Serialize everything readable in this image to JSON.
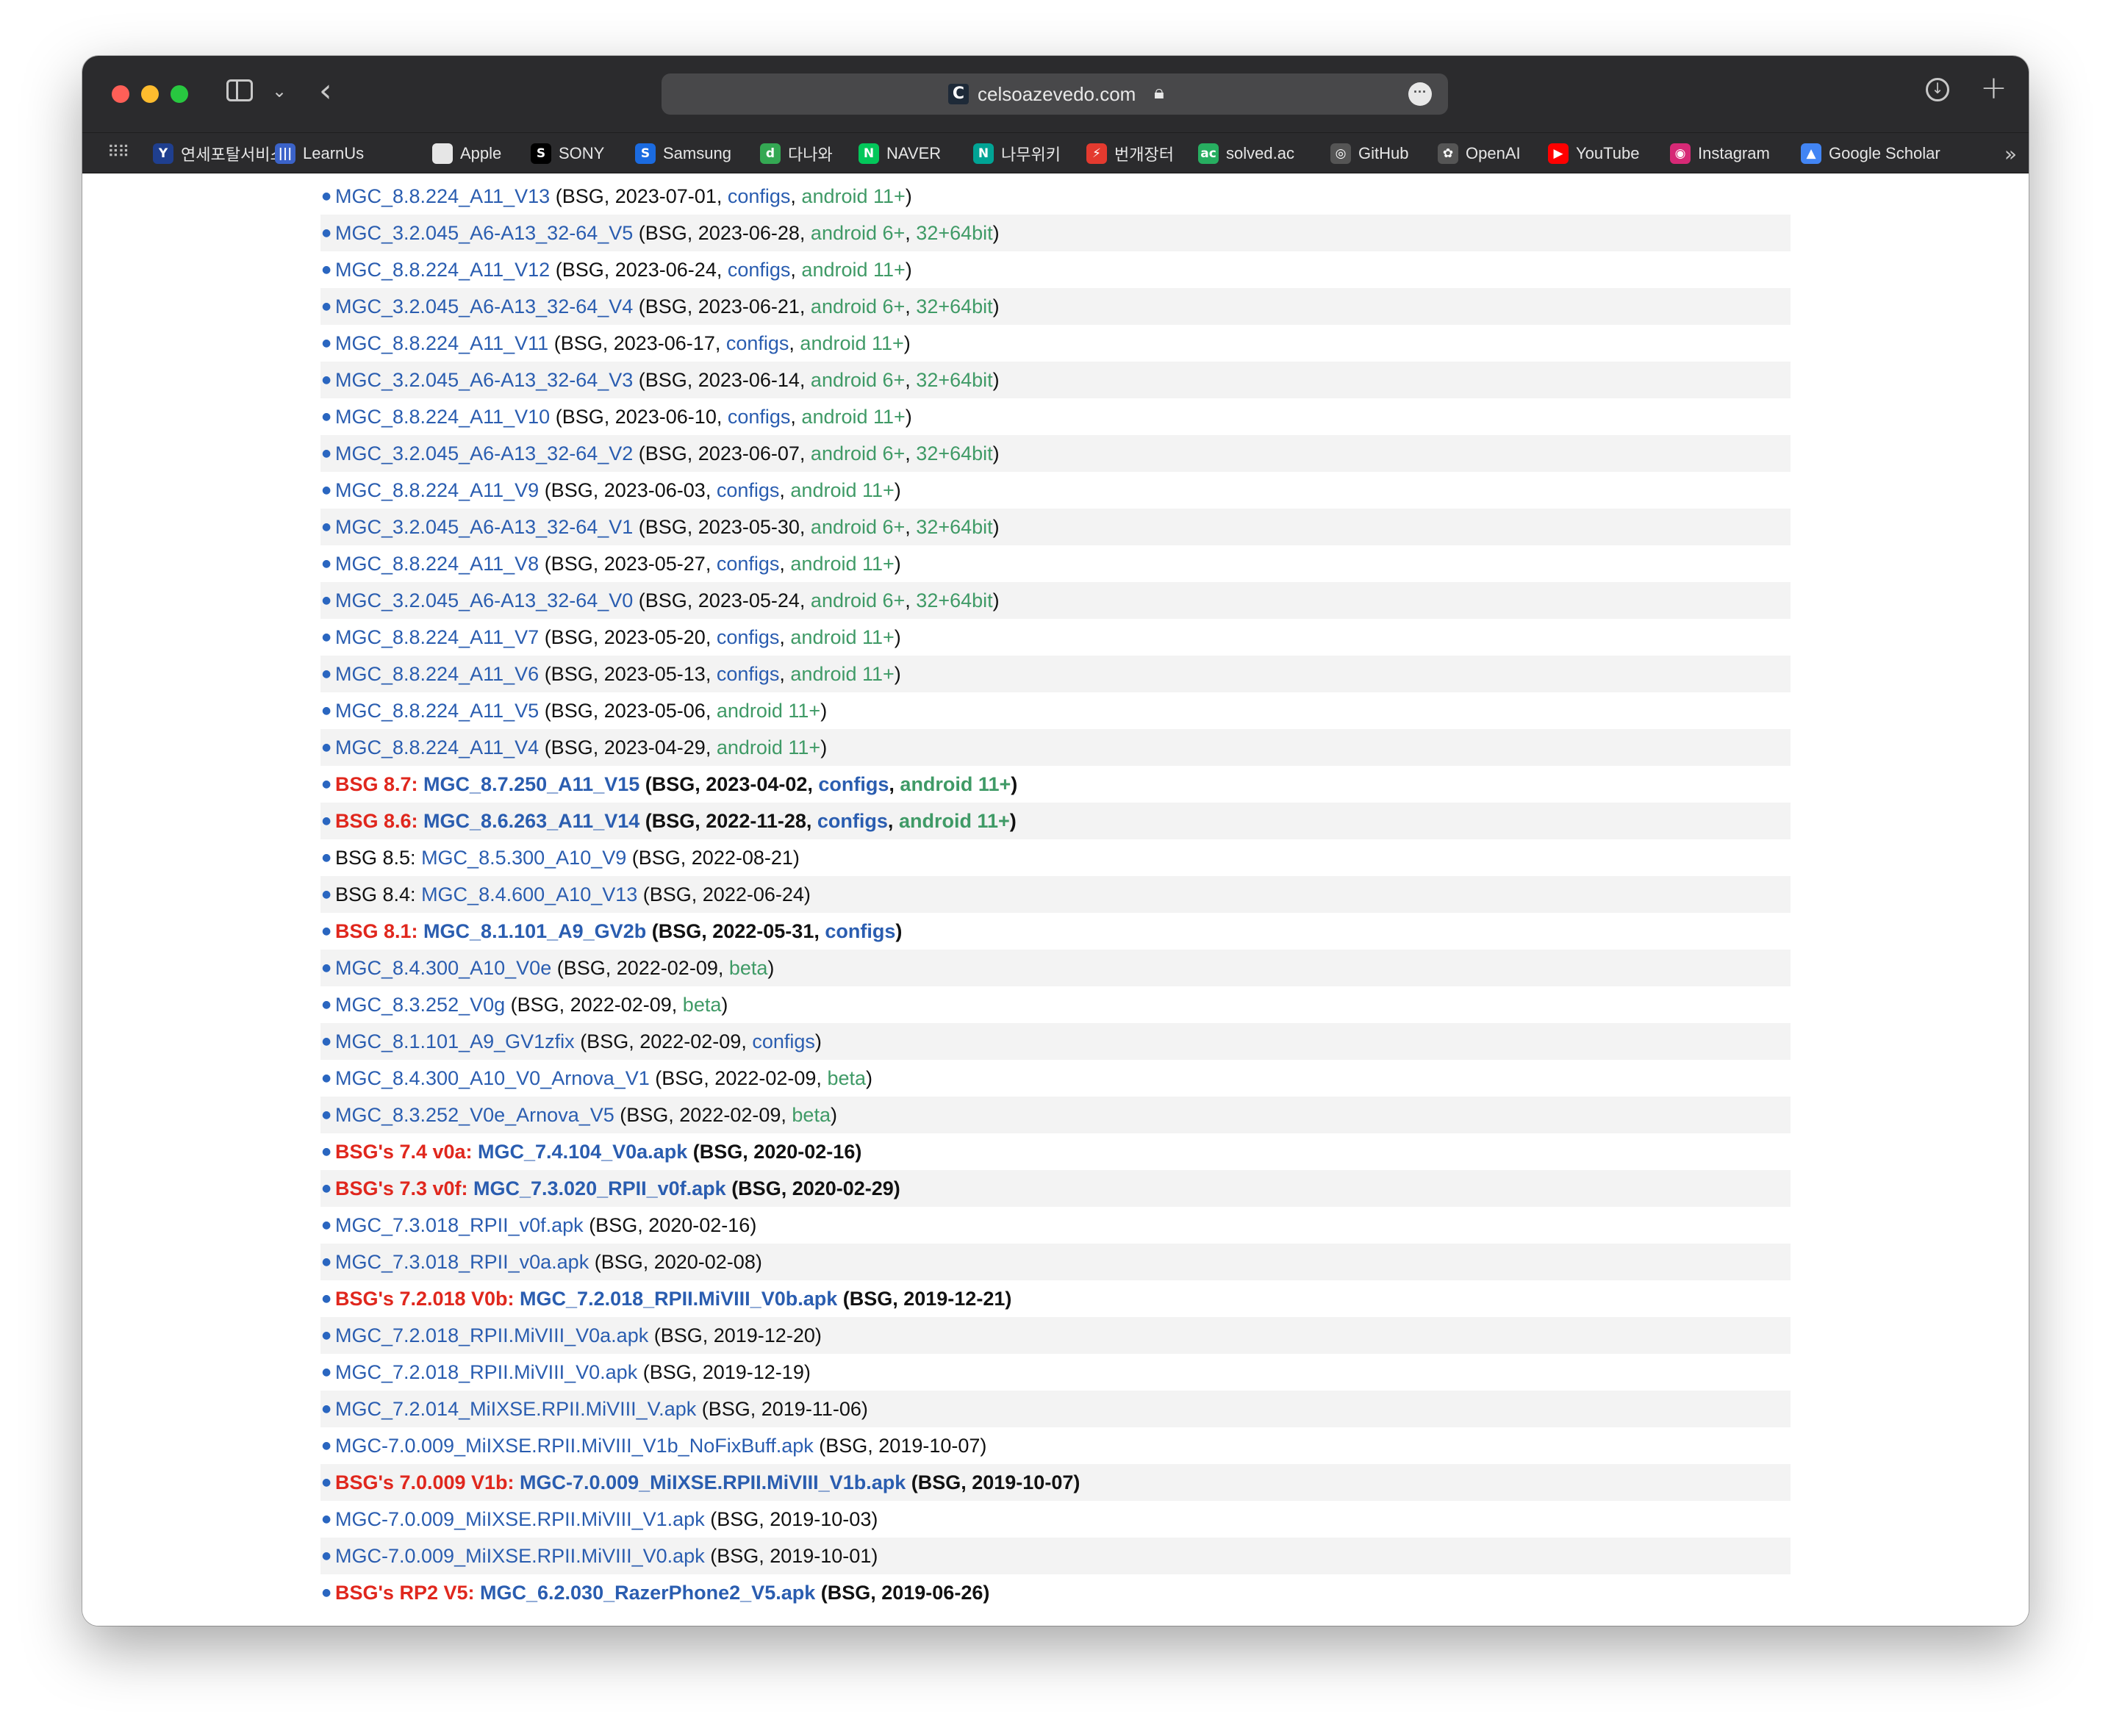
{
  "browser": {
    "url": "celsoazevedo.com",
    "favicon_letter": "C",
    "bookmarks": [
      {
        "label": "연세포탈서비스",
        "icon": "Y",
        "color": "#1f3f8f"
      },
      {
        "label": "LearnUs",
        "icon": "|||",
        "color": "#3b63c9"
      },
      {
        "label": "Apple",
        "icon": "",
        "color": "#e6e6e6"
      },
      {
        "label": "SONY",
        "icon": "S",
        "color": "#000000"
      },
      {
        "label": "Samsung",
        "icon": "S",
        "color": "#1b6be0"
      },
      {
        "label": "다나와",
        "icon": "d",
        "color": "#34a853"
      },
      {
        "label": "NAVER",
        "icon": "N",
        "color": "#03c75a"
      },
      {
        "label": "나무위키",
        "icon": "N",
        "color": "#00a495"
      },
      {
        "label": "번개장터",
        "icon": "⚡",
        "color": "#e43a2f"
      },
      {
        "label": "solved.ac",
        "icon": "ac",
        "color": "#27ae60"
      },
      {
        "label": "GitHub",
        "icon": "◎",
        "color": "#555555"
      },
      {
        "label": "OpenAI",
        "icon": "✿",
        "color": "#555555"
      },
      {
        "label": "YouTube",
        "icon": "▶",
        "color": "#ff0000"
      },
      {
        "label": "Instagram",
        "icon": "◉",
        "color": "#d62976"
      },
      {
        "label": "Google Scholar",
        "icon": "▲",
        "color": "#4285f4"
      }
    ]
  },
  "rows": [
    {
      "bold": false,
      "parts": [
        {
          "t": "MGC_8.8.224_A11_V13",
          "c": "lnk"
        },
        {
          "t": " (BSG, 2023-07-01, ",
          "c": "txt"
        },
        {
          "t": "configs",
          "c": "lnk"
        },
        {
          "t": ", ",
          "c": "txt"
        },
        {
          "t": "android 11+",
          "c": "grn"
        },
        {
          "t": ")",
          "c": "txt"
        }
      ]
    },
    {
      "bold": false,
      "parts": [
        {
          "t": "MGC_3.2.045_A6-A13_32-64_V5",
          "c": "lnk"
        },
        {
          "t": " (BSG, 2023-06-28, ",
          "c": "txt"
        },
        {
          "t": "android 6+",
          "c": "grn"
        },
        {
          "t": ", ",
          "c": "txt"
        },
        {
          "t": "32+64bit",
          "c": "grn"
        },
        {
          "t": ")",
          "c": "txt"
        }
      ]
    },
    {
      "bold": false,
      "parts": [
        {
          "t": "MGC_8.8.224_A11_V12",
          "c": "lnk"
        },
        {
          "t": " (BSG, 2023-06-24, ",
          "c": "txt"
        },
        {
          "t": "configs",
          "c": "lnk"
        },
        {
          "t": ", ",
          "c": "txt"
        },
        {
          "t": "android 11+",
          "c": "grn"
        },
        {
          "t": ")",
          "c": "txt"
        }
      ]
    },
    {
      "bold": false,
      "parts": [
        {
          "t": "MGC_3.2.045_A6-A13_32-64_V4",
          "c": "lnk"
        },
        {
          "t": " (BSG, 2023-06-21, ",
          "c": "txt"
        },
        {
          "t": "android 6+",
          "c": "grn"
        },
        {
          "t": ", ",
          "c": "txt"
        },
        {
          "t": "32+64bit",
          "c": "grn"
        },
        {
          "t": ")",
          "c": "txt"
        }
      ]
    },
    {
      "bold": false,
      "parts": [
        {
          "t": "MGC_8.8.224_A11_V11",
          "c": "lnk"
        },
        {
          "t": " (BSG, 2023-06-17, ",
          "c": "txt"
        },
        {
          "t": "configs",
          "c": "lnk"
        },
        {
          "t": ", ",
          "c": "txt"
        },
        {
          "t": "android 11+",
          "c": "grn"
        },
        {
          "t": ")",
          "c": "txt"
        }
      ]
    },
    {
      "bold": false,
      "parts": [
        {
          "t": "MGC_3.2.045_A6-A13_32-64_V3",
          "c": "lnk"
        },
        {
          "t": " (BSG, 2023-06-14, ",
          "c": "txt"
        },
        {
          "t": "android 6+",
          "c": "grn"
        },
        {
          "t": ", ",
          "c": "txt"
        },
        {
          "t": "32+64bit",
          "c": "grn"
        },
        {
          "t": ")",
          "c": "txt"
        }
      ]
    },
    {
      "bold": false,
      "parts": [
        {
          "t": "MGC_8.8.224_A11_V10",
          "c": "lnk"
        },
        {
          "t": " (BSG, 2023-06-10, ",
          "c": "txt"
        },
        {
          "t": "configs",
          "c": "lnk"
        },
        {
          "t": ", ",
          "c": "txt"
        },
        {
          "t": "android 11+",
          "c": "grn"
        },
        {
          "t": ")",
          "c": "txt"
        }
      ]
    },
    {
      "bold": false,
      "parts": [
        {
          "t": "MGC_3.2.045_A6-A13_32-64_V2",
          "c": "lnk"
        },
        {
          "t": " (BSG, 2023-06-07, ",
          "c": "txt"
        },
        {
          "t": "android 6+",
          "c": "grn"
        },
        {
          "t": ", ",
          "c": "txt"
        },
        {
          "t": "32+64bit",
          "c": "grn"
        },
        {
          "t": ")",
          "c": "txt"
        }
      ]
    },
    {
      "bold": false,
      "parts": [
        {
          "t": "MGC_8.8.224_A11_V9",
          "c": "lnk"
        },
        {
          "t": " (BSG, 2023-06-03, ",
          "c": "txt"
        },
        {
          "t": "configs",
          "c": "lnk"
        },
        {
          "t": ", ",
          "c": "txt"
        },
        {
          "t": "android 11+",
          "c": "grn"
        },
        {
          "t": ")",
          "c": "txt"
        }
      ]
    },
    {
      "bold": false,
      "parts": [
        {
          "t": "MGC_3.2.045_A6-A13_32-64_V1",
          "c": "lnk"
        },
        {
          "t": " (BSG, 2023-05-30, ",
          "c": "txt"
        },
        {
          "t": "android 6+",
          "c": "grn"
        },
        {
          "t": ", ",
          "c": "txt"
        },
        {
          "t": "32+64bit",
          "c": "grn"
        },
        {
          "t": ")",
          "c": "txt"
        }
      ]
    },
    {
      "bold": false,
      "parts": [
        {
          "t": "MGC_8.8.224_A11_V8",
          "c": "lnk"
        },
        {
          "t": " (BSG, 2023-05-27, ",
          "c": "txt"
        },
        {
          "t": "configs",
          "c": "lnk"
        },
        {
          "t": ", ",
          "c": "txt"
        },
        {
          "t": "android 11+",
          "c": "grn"
        },
        {
          "t": ")",
          "c": "txt"
        }
      ]
    },
    {
      "bold": false,
      "parts": [
        {
          "t": "MGC_3.2.045_A6-A13_32-64_V0",
          "c": "lnk"
        },
        {
          "t": " (BSG, 2023-05-24, ",
          "c": "txt"
        },
        {
          "t": "android 6+",
          "c": "grn"
        },
        {
          "t": ", ",
          "c": "txt"
        },
        {
          "t": "32+64bit",
          "c": "grn"
        },
        {
          "t": ")",
          "c": "txt"
        }
      ]
    },
    {
      "bold": false,
      "parts": [
        {
          "t": "MGC_8.8.224_A11_V7",
          "c": "lnk"
        },
        {
          "t": " (BSG, 2023-05-20, ",
          "c": "txt"
        },
        {
          "t": "configs",
          "c": "lnk"
        },
        {
          "t": ", ",
          "c": "txt"
        },
        {
          "t": "android 11+",
          "c": "grn"
        },
        {
          "t": ")",
          "c": "txt"
        }
      ]
    },
    {
      "bold": false,
      "parts": [
        {
          "t": "MGC_8.8.224_A11_V6",
          "c": "lnk"
        },
        {
          "t": " (BSG, 2023-05-13, ",
          "c": "txt"
        },
        {
          "t": "configs",
          "c": "lnk"
        },
        {
          "t": ", ",
          "c": "txt"
        },
        {
          "t": "android 11+",
          "c": "grn"
        },
        {
          "t": ")",
          "c": "txt"
        }
      ]
    },
    {
      "bold": false,
      "parts": [
        {
          "t": "MGC_8.8.224_A11_V5",
          "c": "lnk"
        },
        {
          "t": " (BSG, 2023-05-06, ",
          "c": "txt"
        },
        {
          "t": "android 11+",
          "c": "grn"
        },
        {
          "t": ")",
          "c": "txt"
        }
      ]
    },
    {
      "bold": false,
      "parts": [
        {
          "t": "MGC_8.8.224_A11_V4",
          "c": "lnk"
        },
        {
          "t": " (BSG, 2023-04-29, ",
          "c": "txt"
        },
        {
          "t": "android 11+",
          "c": "grn"
        },
        {
          "t": ")",
          "c": "txt"
        }
      ]
    },
    {
      "bold": true,
      "parts": [
        {
          "t": "BSG 8.7: ",
          "c": "red"
        },
        {
          "t": "MGC_8.7.250_A11_V15",
          "c": "lnk"
        },
        {
          "t": " (BSG, 2023-04-02, ",
          "c": "txt"
        },
        {
          "t": "configs",
          "c": "lnk"
        },
        {
          "t": ", ",
          "c": "txt"
        },
        {
          "t": "android 11+",
          "c": "grn"
        },
        {
          "t": ")",
          "c": "txt"
        }
      ]
    },
    {
      "bold": true,
      "parts": [
        {
          "t": "BSG 8.6: ",
          "c": "red"
        },
        {
          "t": "MGC_8.6.263_A11_V14",
          "c": "lnk"
        },
        {
          "t": " (BSG, 2022-11-28, ",
          "c": "txt"
        },
        {
          "t": "configs",
          "c": "lnk"
        },
        {
          "t": ", ",
          "c": "txt"
        },
        {
          "t": "android 11+",
          "c": "grn"
        },
        {
          "t": ")",
          "c": "txt"
        }
      ]
    },
    {
      "bold": false,
      "parts": [
        {
          "t": "BSG 8.5: ",
          "c": "txt"
        },
        {
          "t": "MGC_8.5.300_A10_V9",
          "c": "lnk"
        },
        {
          "t": " (BSG, 2022-08-21)",
          "c": "txt"
        }
      ]
    },
    {
      "bold": false,
      "parts": [
        {
          "t": "BSG 8.4: ",
          "c": "txt"
        },
        {
          "t": "MGC_8.4.600_A10_V13",
          "c": "lnk"
        },
        {
          "t": " (BSG, 2022-06-24)",
          "c": "txt"
        }
      ]
    },
    {
      "bold": true,
      "parts": [
        {
          "t": "BSG 8.1: ",
          "c": "red"
        },
        {
          "t": "MGC_8.1.101_A9_GV2b",
          "c": "lnk"
        },
        {
          "t": " (BSG, 2022-05-31, ",
          "c": "txt"
        },
        {
          "t": "configs",
          "c": "lnk"
        },
        {
          "t": ")",
          "c": "txt"
        }
      ]
    },
    {
      "bold": false,
      "parts": [
        {
          "t": "MGC_8.4.300_A10_V0e",
          "c": "lnk"
        },
        {
          "t": " (BSG, 2022-02-09, ",
          "c": "txt"
        },
        {
          "t": "beta",
          "c": "grn"
        },
        {
          "t": ")",
          "c": "txt"
        }
      ]
    },
    {
      "bold": false,
      "parts": [
        {
          "t": "MGC_8.3.252_V0g",
          "c": "lnk"
        },
        {
          "t": " (BSG, 2022-02-09, ",
          "c": "txt"
        },
        {
          "t": "beta",
          "c": "grn"
        },
        {
          "t": ")",
          "c": "txt"
        }
      ]
    },
    {
      "bold": false,
      "parts": [
        {
          "t": "MGC_8.1.101_A9_GV1zfix",
          "c": "lnk"
        },
        {
          "t": " (BSG, 2022-02-09, ",
          "c": "txt"
        },
        {
          "t": "configs",
          "c": "lnk"
        },
        {
          "t": ")",
          "c": "txt"
        }
      ]
    },
    {
      "bold": false,
      "parts": [
        {
          "t": "MGC_8.4.300_A10_V0_Arnova_V1",
          "c": "lnk"
        },
        {
          "t": " (BSG, 2022-02-09, ",
          "c": "txt"
        },
        {
          "t": "beta",
          "c": "grn"
        },
        {
          "t": ")",
          "c": "txt"
        }
      ]
    },
    {
      "bold": false,
      "parts": [
        {
          "t": "MGC_8.3.252_V0e_Arnova_V5",
          "c": "lnk"
        },
        {
          "t": " (BSG, 2022-02-09, ",
          "c": "txt"
        },
        {
          "t": "beta",
          "c": "grn"
        },
        {
          "t": ")",
          "c": "txt"
        }
      ]
    },
    {
      "bold": true,
      "parts": [
        {
          "t": "BSG's 7.4 v0a: ",
          "c": "red"
        },
        {
          "t": "MGC_7.4.104_V0a.apk",
          "c": "lnk"
        },
        {
          "t": " (BSG, 2020-02-16)",
          "c": "txt"
        }
      ]
    },
    {
      "bold": true,
      "parts": [
        {
          "t": "BSG's 7.3 v0f: ",
          "c": "red"
        },
        {
          "t": "MGC_7.3.020_RPII_v0f.apk",
          "c": "lnk"
        },
        {
          "t": " (BSG, 2020-02-29)",
          "c": "txt"
        }
      ]
    },
    {
      "bold": false,
      "parts": [
        {
          "t": "MGC_7.3.018_RPII_v0f.apk",
          "c": "lnk"
        },
        {
          "t": " (BSG, 2020-02-16)",
          "c": "txt"
        }
      ]
    },
    {
      "bold": false,
      "parts": [
        {
          "t": "MGC_7.3.018_RPII_v0a.apk",
          "c": "lnk"
        },
        {
          "t": " (BSG, 2020-02-08)",
          "c": "txt"
        }
      ]
    },
    {
      "bold": true,
      "parts": [
        {
          "t": "BSG's 7.2.018 V0b: ",
          "c": "red"
        },
        {
          "t": "MGC_7.2.018_RPII.MiVIII_V0b.apk",
          "c": "lnk"
        },
        {
          "t": " (BSG, 2019-12-21)",
          "c": "txt"
        }
      ]
    },
    {
      "bold": false,
      "parts": [
        {
          "t": "MGC_7.2.018_RPII.MiVIII_V0a.apk",
          "c": "lnk"
        },
        {
          "t": " (BSG, 2019-12-20)",
          "c": "txt"
        }
      ]
    },
    {
      "bold": false,
      "parts": [
        {
          "t": "MGC_7.2.018_RPII.MiVIII_V0.apk",
          "c": "lnk"
        },
        {
          "t": " (BSG, 2019-12-19)",
          "c": "txt"
        }
      ]
    },
    {
      "bold": false,
      "parts": [
        {
          "t": "MGC_7.2.014_MiIXSE.RPII.MiVIII_V.apk",
          "c": "lnk"
        },
        {
          "t": " (BSG, 2019-11-06)",
          "c": "txt"
        }
      ]
    },
    {
      "bold": false,
      "parts": [
        {
          "t": "MGC-7.0.009_MiIXSE.RPII.MiVIII_V1b_NoFixBuff.apk",
          "c": "lnk"
        },
        {
          "t": " (BSG, 2019-10-07)",
          "c": "txt"
        }
      ]
    },
    {
      "bold": true,
      "parts": [
        {
          "t": "BSG's 7.0.009 V1b: ",
          "c": "red"
        },
        {
          "t": "MGC-7.0.009_MiIXSE.RPII.MiVIII_V1b.apk",
          "c": "lnk"
        },
        {
          "t": " (BSG, 2019-10-07)",
          "c": "txt"
        }
      ]
    },
    {
      "bold": false,
      "parts": [
        {
          "t": "MGC-7.0.009_MiIXSE.RPII.MiVIII_V1.apk",
          "c": "lnk"
        },
        {
          "t": " (BSG, 2019-10-03)",
          "c": "txt"
        }
      ]
    },
    {
      "bold": false,
      "parts": [
        {
          "t": "MGC-7.0.009_MiIXSE.RPII.MiVIII_V0.apk",
          "c": "lnk"
        },
        {
          "t": " (BSG, 2019-10-01)",
          "c": "txt"
        }
      ]
    },
    {
      "bold": true,
      "parts": [
        {
          "t": "BSG's RP2 V5: ",
          "c": "red"
        },
        {
          "t": "MGC_6.2.030_RazerPhone2_V5.apk",
          "c": "lnk"
        },
        {
          "t": " (BSG, 2019-06-26)",
          "c": "txt"
        }
      ]
    }
  ]
}
